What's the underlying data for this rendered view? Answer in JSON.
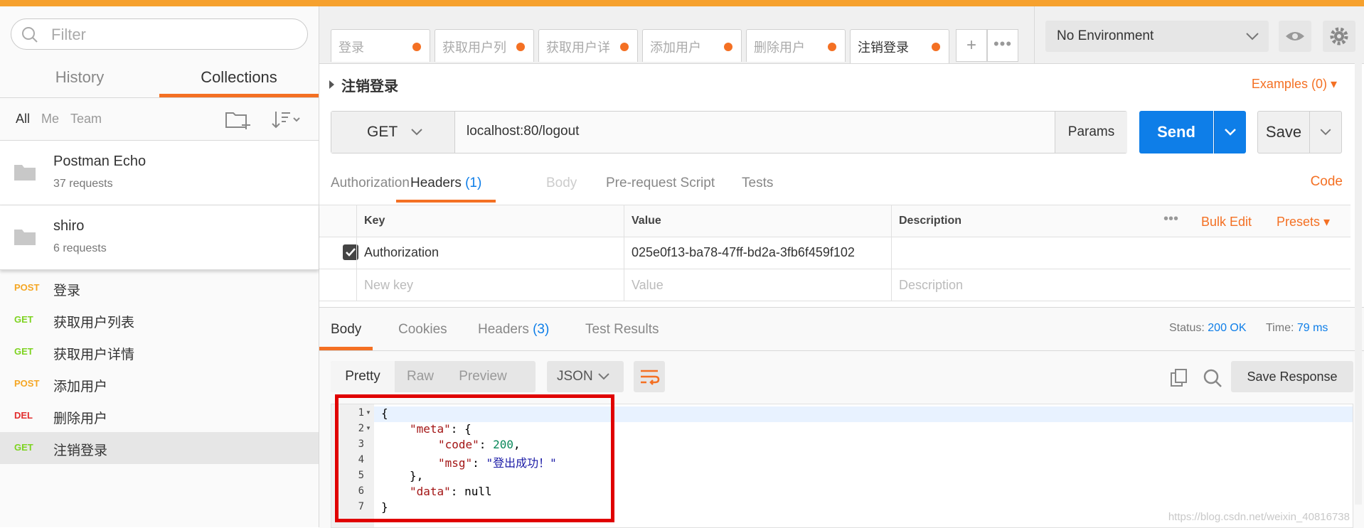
{
  "sidebar": {
    "filter_placeholder": "Filter",
    "tabs": [
      {
        "label": "History"
      },
      {
        "label": "Collections"
      }
    ],
    "filters": [
      "All",
      "Me",
      "Team"
    ],
    "collections": [
      {
        "name": "Postman Echo",
        "count": "37 requests"
      },
      {
        "name": "shiro",
        "count": "6 requests"
      }
    ],
    "requests": [
      {
        "method": "POST",
        "name": "登录",
        "color": "#f5a623"
      },
      {
        "method": "GET",
        "name": "获取用户列表",
        "color": "#7ed321"
      },
      {
        "method": "GET",
        "name": "获取用户详情",
        "color": "#7ed321"
      },
      {
        "method": "POST",
        "name": "添加用户",
        "color": "#f5a623"
      },
      {
        "method": "DEL",
        "name": "删除用户",
        "color": "#e22d2d"
      },
      {
        "method": "GET",
        "name": "注销登录",
        "color": "#7ed321"
      }
    ]
  },
  "tabs": [
    "登录",
    "获取用户列",
    "获取用户详",
    "添加用户",
    "删除用户",
    "注销登录"
  ],
  "environment": {
    "label": "No Environment"
  },
  "request": {
    "name": "注销登录",
    "examples": "Examples (0)",
    "method": "GET",
    "url": "localhost:80/logout",
    "params_label": "Params",
    "send_label": "Send",
    "save_label": "Save"
  },
  "request_tabs": {
    "authorization": "Authorization",
    "headers": "Headers",
    "headers_count": "(1)",
    "body": "Body",
    "prerequest": "Pre-request Script",
    "tests": "Tests",
    "code": "Code"
  },
  "headers_table": {
    "col_key": "Key",
    "col_value": "Value",
    "col_description": "Description",
    "bulk_edit": "Bulk Edit",
    "presets": "Presets",
    "row_key": "Authorization",
    "row_value": "025e0f13-ba78-47ff-bd2a-3fb6f459f102",
    "new_key_placeholder": "New key",
    "value_placeholder": "Value",
    "description_placeholder": "Description"
  },
  "response": {
    "tabs": {
      "body": "Body",
      "cookies": "Cookies",
      "headers": "Headers",
      "headers_count": "(3)",
      "test_results": "Test Results"
    },
    "status_label": "Status:",
    "status_value": "200 OK",
    "time_label": "Time:",
    "time_value": "79 ms",
    "view_modes": [
      "Pretty",
      "Raw",
      "Preview"
    ],
    "format": "JSON",
    "save_response": "Save Response",
    "line_numbers": [
      "1",
      "2",
      "3",
      "4",
      "5",
      "6",
      "7"
    ],
    "code_lines": {
      "l1": "{",
      "l2_key": "\"meta\"",
      "l2_rest": ": {",
      "l3_key": "\"code\"",
      "l3_sep": ": ",
      "l3_val": "200",
      "l3_end": ",",
      "l4_key": "\"msg\"",
      "l4_sep": ": ",
      "l4_val": "\"登出成功！\"",
      "l5": "},",
      "l6_key": "\"data\"",
      "l6_rest": ": null",
      "l7": "}"
    }
  },
  "watermark": "https://blog.csdn.net/weixin_40816738",
  "colors": {
    "accent": "#f47023",
    "send": "#0e7ee8",
    "highlight_box": "#e00000"
  }
}
